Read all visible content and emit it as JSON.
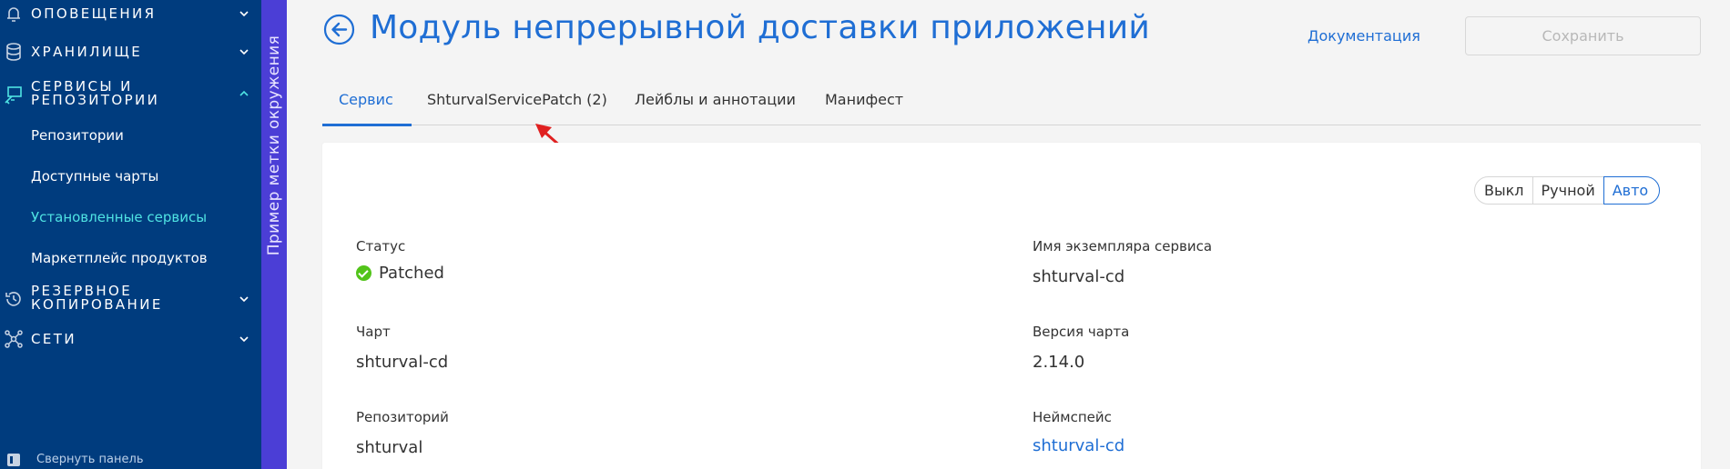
{
  "sidebar": {
    "sections": [
      {
        "label": "ОПОВЕЩЕНИЯ",
        "icon": "bell-icon",
        "expanded": false
      },
      {
        "label": "ХРАНИЛИЩЕ",
        "icon": "database-icon",
        "expanded": false
      },
      {
        "label_line1": "СЕРВИСЫ И",
        "label_line2": "РЕПОЗИТОРИИ",
        "icon": "services-icon",
        "expanded": true
      },
      {
        "label_line1": "РЕЗЕРВНОЕ",
        "label_line2": "КОПИРОВАНИЕ",
        "icon": "backup-icon",
        "expanded": false
      },
      {
        "label": "СЕТИ",
        "icon": "network-icon",
        "expanded": false
      }
    ],
    "items": [
      {
        "label": "Репозитории",
        "active": false
      },
      {
        "label": "Доступные чарты",
        "active": false
      },
      {
        "label": "Установленные сервисы",
        "active": true
      },
      {
        "label": "Маркетплейс продуктов",
        "active": false
      }
    ],
    "collapse_label": "Свернуть панель",
    "colors": {
      "background": "#003c7e",
      "active_item": "#4fe3e3"
    }
  },
  "env_label": "Пример метки окружения",
  "header": {
    "title": "Модуль непрерывной доставки приложений",
    "doc_link": "Документация",
    "save_label": "Сохранить"
  },
  "tabs": [
    {
      "label": "Сервис",
      "active": true
    },
    {
      "label": "ShturvalServicePatch (2)",
      "active": false
    },
    {
      "label": "Лейблы и аннотации",
      "active": false
    },
    {
      "label": "Манифест",
      "active": false
    }
  ],
  "mode_switch": {
    "options": [
      "Выкл",
      "Ручной",
      "Авто"
    ],
    "selected": "Авто"
  },
  "fields": {
    "status": {
      "label": "Статус",
      "value": "Patched",
      "color": "#52c41a"
    },
    "instance": {
      "label": "Имя экземпляра сервиса",
      "value": "shturval-cd"
    },
    "chart": {
      "label": "Чарт",
      "value": "shturval-cd"
    },
    "chart_version": {
      "label": "Версия чарта",
      "value": "2.14.0"
    },
    "repository": {
      "label": "Репозиторий",
      "value": "shturval"
    },
    "namespace": {
      "label": "Неймспейс",
      "value": "shturval-cd"
    }
  },
  "colors": {
    "accent": "#1f6ed4",
    "env_strip": "#4b3ed6",
    "annotation_arrow": "#e02020"
  }
}
